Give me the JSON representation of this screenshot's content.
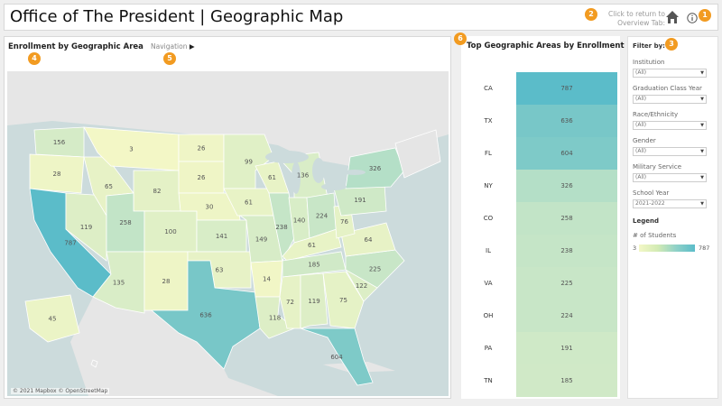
{
  "header": {
    "title": "Office of The President | Geographic Map",
    "return_text_line1": "Click to return to",
    "return_text_line2": "Overview Tab:",
    "home_icon": "home-icon",
    "info_icon": "info-icon"
  },
  "badges": [
    "1",
    "2",
    "3",
    "4",
    "5",
    "6"
  ],
  "map": {
    "title": "Enrollment by Geographic Area",
    "navigation_label": "Navigation",
    "navigation_icon": "play-right-icon",
    "attribution": "© 2021 Mapbox © OpenStreetMap",
    "state_values": [
      {
        "state": "WA",
        "value": "156"
      },
      {
        "state": "OR",
        "value": "28"
      },
      {
        "state": "CA",
        "value": "787"
      },
      {
        "state": "NV",
        "value": "119"
      },
      {
        "state": "ID",
        "value": "65"
      },
      {
        "state": "UT",
        "value": "258"
      },
      {
        "state": "AZ",
        "value": "135"
      },
      {
        "state": "NM",
        "value": "28"
      },
      {
        "state": "CO",
        "value": "100"
      },
      {
        "state": "WY",
        "value": "82"
      },
      {
        "state": "MT",
        "value": "3"
      },
      {
        "state": "ND",
        "value": "26"
      },
      {
        "state": "SD",
        "value": "26"
      },
      {
        "state": "NE",
        "value": "30"
      },
      {
        "state": "KS",
        "value": "141"
      },
      {
        "state": "OK",
        "value": "63"
      },
      {
        "state": "TX",
        "value": "636"
      },
      {
        "state": "MN",
        "value": "99"
      },
      {
        "state": "IA",
        "value": "61"
      },
      {
        "state": "MO",
        "value": "149"
      },
      {
        "state": "AR",
        "value": "14"
      },
      {
        "state": "LA",
        "value": "118"
      },
      {
        "state": "WI",
        "value": "61"
      },
      {
        "state": "IL",
        "value": "238"
      },
      {
        "state": "IN",
        "value": "140"
      },
      {
        "state": "MI",
        "value": "136"
      },
      {
        "state": "OH",
        "value": "224"
      },
      {
        "state": "KY",
        "value": "61"
      },
      {
        "state": "TN",
        "value": "185"
      },
      {
        "state": "MS",
        "value": "72"
      },
      {
        "state": "AL",
        "value": "119"
      },
      {
        "state": "GA",
        "value": "75"
      },
      {
        "state": "FL",
        "value": "604"
      },
      {
        "state": "SC",
        "value": "122"
      },
      {
        "state": "NC",
        "value": "225"
      },
      {
        "state": "VA",
        "value": "64"
      },
      {
        "state": "WV",
        "value": "76"
      },
      {
        "state": "PA",
        "value": "191"
      },
      {
        "state": "NY",
        "value": "326"
      },
      {
        "state": "AK",
        "value": "45"
      }
    ]
  },
  "ranking": {
    "title": "Top Geographic Areas by Enrollment",
    "rows": [
      {
        "label": "CA",
        "value": "787"
      },
      {
        "label": "TX",
        "value": "636"
      },
      {
        "label": "FL",
        "value": "604"
      },
      {
        "label": "NY",
        "value": "326"
      },
      {
        "label": "CO",
        "value": "258"
      },
      {
        "label": "IL",
        "value": "238"
      },
      {
        "label": "VA",
        "value": "225"
      },
      {
        "label": "OH",
        "value": "224"
      },
      {
        "label": "PA",
        "value": "191"
      },
      {
        "label": "TN",
        "value": "185"
      }
    ]
  },
  "filters": {
    "title": "Filter by:",
    "items": [
      {
        "label": "Institution",
        "value": "(All)"
      },
      {
        "label": "Graduation Class Year",
        "value": "(All)"
      },
      {
        "label": "Race/Ethnicity",
        "value": "(All)"
      },
      {
        "label": "Gender",
        "value": "(All)"
      },
      {
        "label": "Military Service",
        "value": "(All)"
      },
      {
        "label": "School Year",
        "value": "2021-2022"
      }
    ]
  },
  "legend": {
    "title": "Legend",
    "measure": "# of Students",
    "min": "3",
    "max": "787"
  },
  "colors": {
    "badge": "#f29b21",
    "scale_low": "#f3f7c6",
    "scale_high": "#5bbcc9",
    "water": "#ccdbdc",
    "land": "#e5e5e5"
  }
}
